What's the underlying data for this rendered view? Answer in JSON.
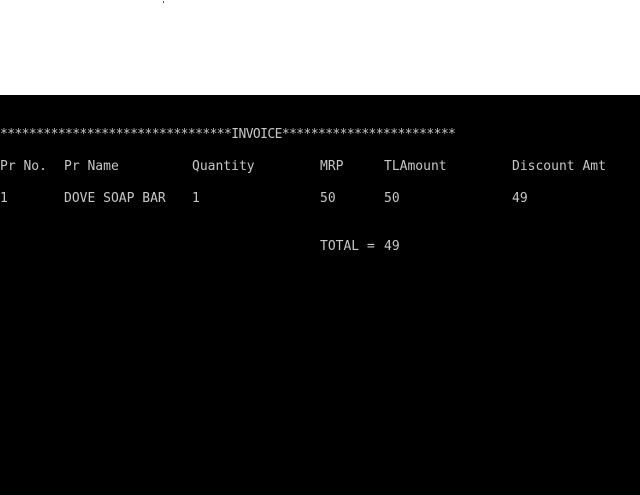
{
  "console": {
    "banner": "********************************INVOICE************************",
    "headers": {
      "pr_no": "Pr No.",
      "pr_name": "Pr Name",
      "quantity": "Quantity",
      "mrp": "MRP",
      "tl_amount": "TLAmount",
      "discount_amt": "Discount Amt"
    },
    "row": {
      "pr_no": "1",
      "pr_name": "DOVE SOAP BAR",
      "quantity": "1",
      "mrp": "50",
      "tl_amount": "50",
      "discount_amt": "49"
    },
    "total_label": "TOTAL = ",
    "total_value": "49"
  },
  "colors": {
    "background": "#000000",
    "text": "#c7c7c7"
  }
}
